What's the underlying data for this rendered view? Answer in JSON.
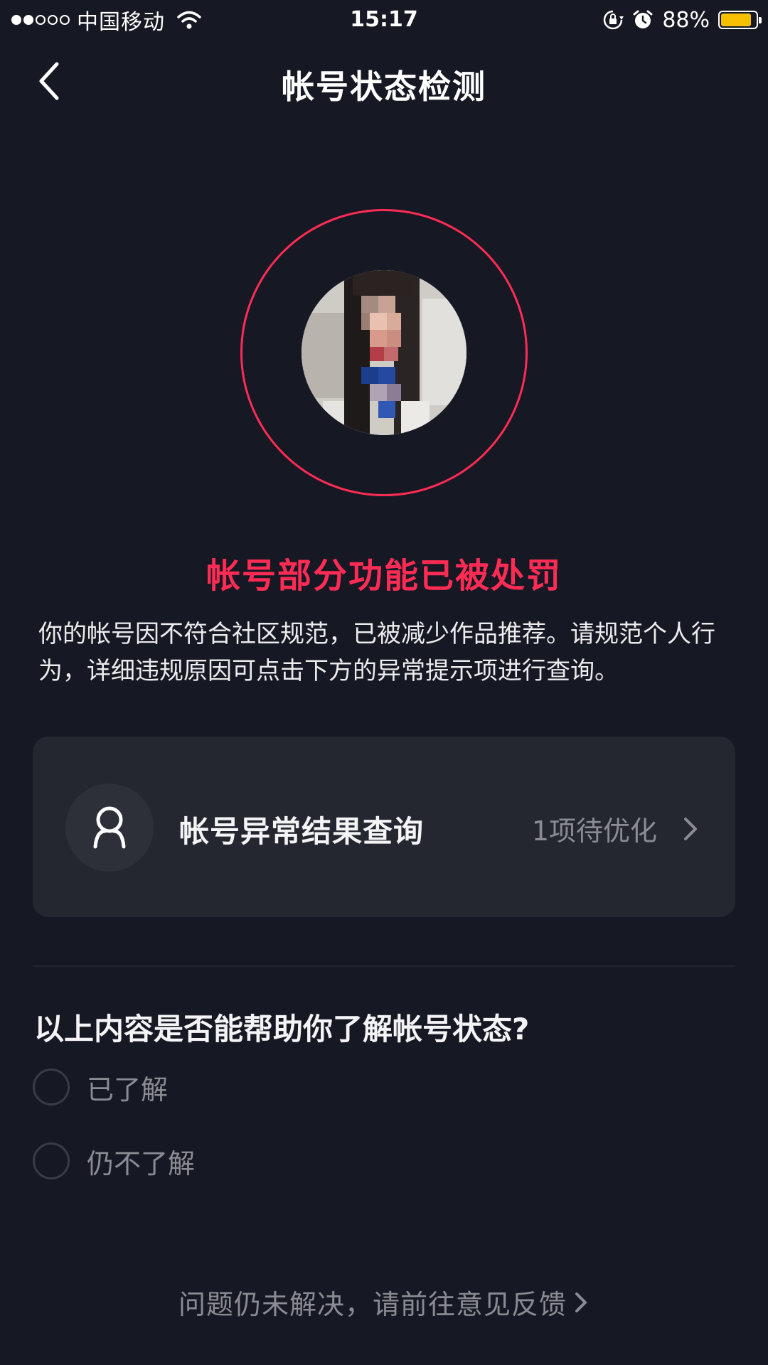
{
  "status_bar": {
    "carrier": "中国移动",
    "time": "15:17",
    "battery_percent": "88%",
    "battery_level": 0.88,
    "signal_bars_filled": 2,
    "signal_bars_total": 5
  },
  "nav": {
    "title": "帐号状态检测"
  },
  "colors": {
    "background": "#161823",
    "accent": "#fe2c55",
    "card": "#242630",
    "muted": "#8b8c93",
    "battery": "#f5c000"
  },
  "status": {
    "headline": "帐号部分功能已被处罚",
    "description": "你的帐号因不符合社区规范，已被减少作品推荐。请规范个人行为，详细违规原因可点击下方的异常提示项进行查询。"
  },
  "card": {
    "icon": "user-icon",
    "title": "帐号异常结果查询",
    "status": "1项待优化"
  },
  "survey": {
    "question": "以上内容是否能帮助你了解帐号状态?",
    "options": [
      {
        "label": "已了解"
      },
      {
        "label": "仍不了解"
      }
    ]
  },
  "footer": {
    "feedback_link": "问题仍未解决，请前往意见反馈"
  }
}
